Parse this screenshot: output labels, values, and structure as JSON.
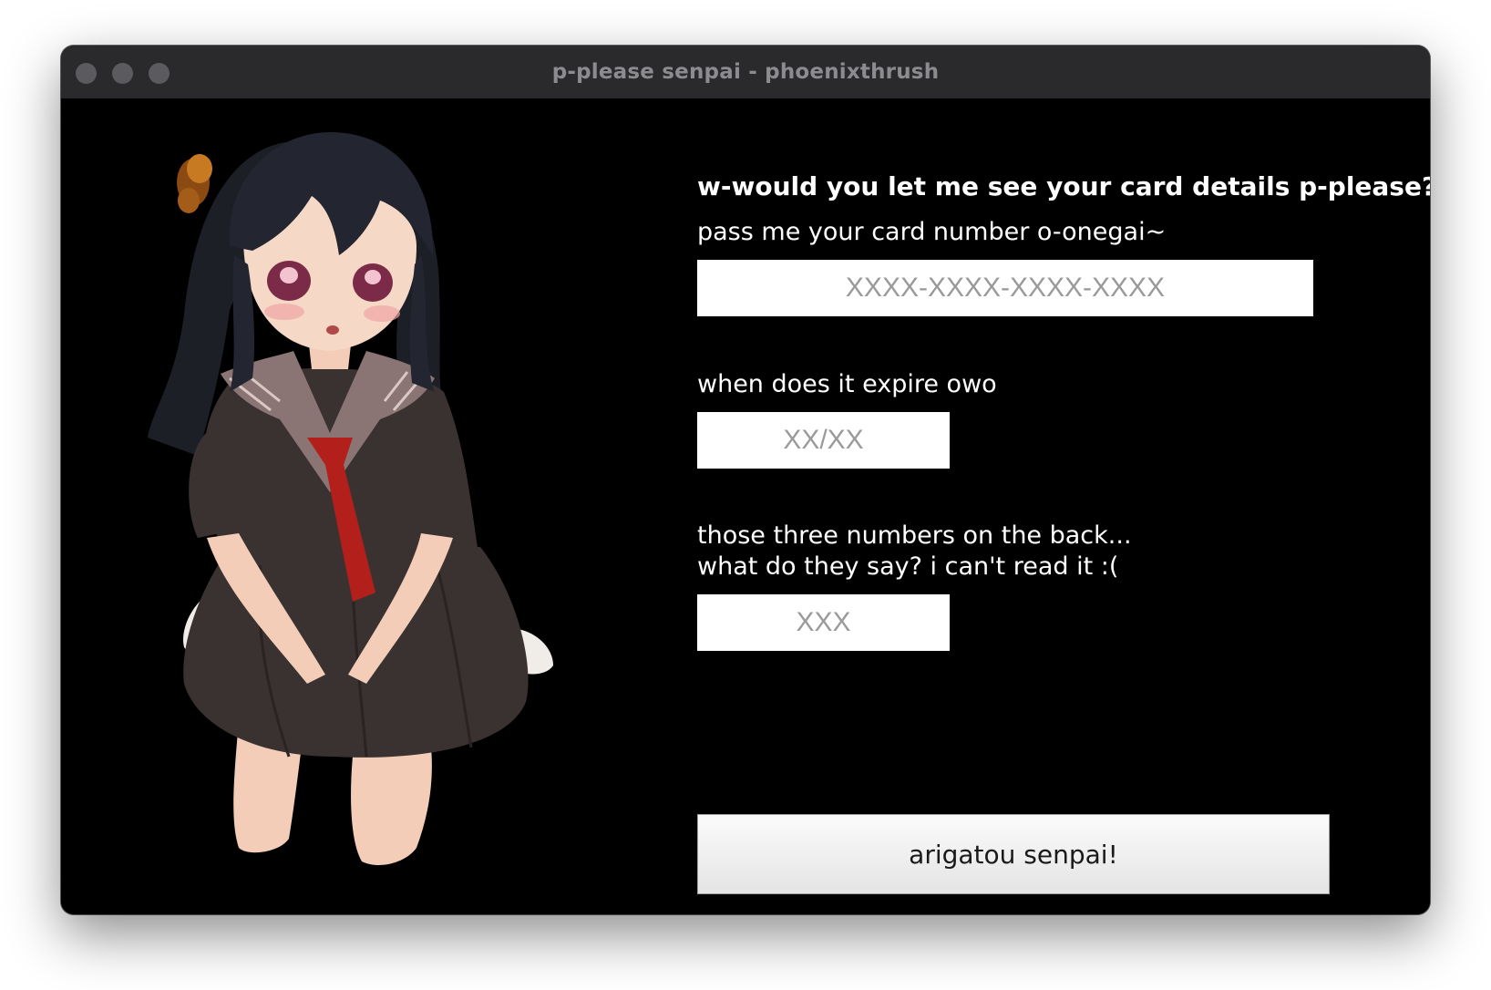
{
  "window": {
    "title": "p-please senpai - phoenixthrush"
  },
  "illustration": {
    "icon": "anime-girl-illustration"
  },
  "form": {
    "heading": "w-would you let me see your card details p-please?",
    "card_number": {
      "label": "pass me your card number o-onegai~",
      "value": "",
      "placeholder": "XXXX-XXXX-XXXX-XXXX"
    },
    "expiry": {
      "label": "when does it expire owo",
      "value": "",
      "placeholder": "XX/XX"
    },
    "cvv": {
      "label": "those three numbers on the back...\nwhat do they say? i can't read it :(",
      "value": "",
      "placeholder": "XXX"
    },
    "submit_label": "arigatou senpai!"
  },
  "colors": {
    "window_background": "#000000",
    "titlebar": "#2a2a2c",
    "title_text": "#8c8c90",
    "text": "#ffffff",
    "field_background": "#ffffff",
    "placeholder": "#9a9a9a"
  }
}
